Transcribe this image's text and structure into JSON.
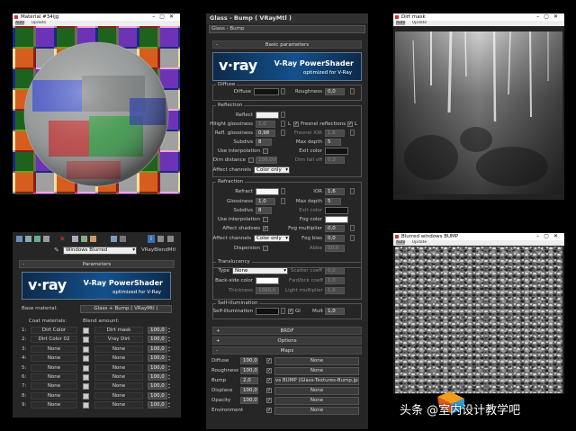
{
  "material_window": {
    "title": "Material #34ijg",
    "menu": [
      "Auto",
      "Update"
    ]
  },
  "editor": {
    "title": "Glass - Bump  ( VRayMtl )",
    "subtitle": "Glass - Bump",
    "rollout_basic": "Basic parameters",
    "banner": {
      "logo": "v·ray",
      "line1": "V-Ray PowerShader",
      "line2": "optimized for V-Ray"
    },
    "diffuse": {
      "group": "Diffuse",
      "diffuse_label": "Diffuse",
      "roughness_label": "Roughness",
      "roughness_value": "0,0"
    },
    "reflection": {
      "group": "Reflection",
      "reflect_label": "Reflect",
      "hilight_label": "Hilight glossiness",
      "hilight_value": "1,0",
      "hilight_L": "L",
      "refl_gloss_label": "Refl. glossiness",
      "refl_gloss_value": "0,98",
      "subdivs_label": "Subdivs",
      "subdivs_value": "8",
      "use_interp_label": "Use interpolation",
      "dim_distance_label": "Dim distance",
      "dim_distance_value": "100,0m",
      "affect_label": "Affect channels",
      "affect_value": "Color only",
      "fresnel_label": "Fresnel reflections",
      "fresnel_L": "L",
      "fresnel_ior_label": "Fresnel IOR",
      "fresnel_ior_value": "1,6",
      "max_depth_label": "Max depth",
      "max_depth_value": "5",
      "exit_color_label": "Exit color",
      "dim_falloff_label": "Dim fall off",
      "dim_falloff_value": "0,0"
    },
    "refraction": {
      "group": "Refraction",
      "refract_label": "Refract",
      "ior_label": "IOR",
      "ior_value": "1,6",
      "glossiness_label": "Glossiness",
      "glossiness_value": "1,0",
      "max_depth_label": "Max depth",
      "max_depth_value": "5",
      "subdivs_label": "Subdivs",
      "subdivs_value": "8",
      "exit_color_label": "Exit color",
      "use_interp_label": "Use interpolation",
      "fog_color_label": "Fog color",
      "affect_shadows_label": "Affect shadows",
      "fog_mult_label": "Fog multiplier",
      "fog_mult_value": "0,0",
      "affect_label": "Affect channels",
      "affect_value": "Color only",
      "fog_bias_label": "Fog bias",
      "fog_bias_value": "0,0",
      "dispersion_label": "Dispersion",
      "abbe_label": "Abbe",
      "abbe_value": "50,0"
    },
    "translucency": {
      "group": "Translucency",
      "type_label": "Type",
      "type_value": "None",
      "backside_label": "Back-side color",
      "thickness_label": "Thickness",
      "thickness_value": "1000,0",
      "scatter_label": "Scatter coeff",
      "scatter_value": "0,0",
      "fwd_label": "Fwd/bck coeff",
      "fwd_value": "1,0",
      "light_label": "Light multiplier",
      "light_value": "1,0"
    },
    "self_illum": {
      "group": "Self-illumination",
      "label": "Self-illumination",
      "gi_label": "GI",
      "mult_label": "Mult",
      "mult_value": "1,0"
    },
    "rollouts": [
      "BRDF",
      "Options",
      "Maps"
    ],
    "maps": [
      {
        "name": "Diffuse",
        "value": "100,0",
        "map": "None"
      },
      {
        "name": "Roughness",
        "value": "100,0",
        "map": "None"
      },
      {
        "name": "Bump",
        "value": "2,0",
        "map": "vs BUMP (Glass-Textures-Bump.jpg)"
      },
      {
        "name": "Displace",
        "value": "100,0",
        "map": "None"
      },
      {
        "name": "Opacity",
        "value": "100,0",
        "map": "None"
      },
      {
        "name": "Environment",
        "value": "",
        "map": "None"
      }
    ]
  },
  "blend_panel": {
    "dropdown_value": "Windows Blurred",
    "type_label": "VRayBlendMtl",
    "rollout": "Parameters",
    "banner": {
      "logo": "v·ray",
      "line1": "V-Ray PowerShader",
      "line2": "optimized for V-Ray"
    },
    "base_label": "Base material:",
    "base_value": "Glass + Bump  ( VRayMtl )",
    "coat_header": "Coat materials:",
    "blend_header": "Blend amount:",
    "rows": [
      {
        "num": "1:",
        "coat": "Dirt Color",
        "blend": "Dirt mask",
        "amt": "100,0"
      },
      {
        "num": "2:",
        "coat": "Dirt Color 02",
        "blend": "Vray Dirt",
        "amt": "100,0"
      },
      {
        "num": "3:",
        "coat": "None",
        "blend": "None",
        "amt": "100,0"
      },
      {
        "num": "4:",
        "coat": "None",
        "blend": "None",
        "amt": "100,0"
      },
      {
        "num": "5:",
        "coat": "None",
        "blend": "None",
        "amt": "100,0"
      },
      {
        "num": "6:",
        "coat": "None",
        "blend": "None",
        "amt": "100,0"
      },
      {
        "num": "7:",
        "coat": "None",
        "blend": "None",
        "amt": "100,0"
      },
      {
        "num": "8:",
        "coat": "None",
        "blend": "None",
        "amt": "100,0"
      },
      {
        "num": "9:",
        "coat": "None",
        "blend": "None",
        "amt": "100,0"
      }
    ]
  },
  "dirt_window": {
    "title": "Dirt mask",
    "menu": [
      "Auto",
      "Update"
    ]
  },
  "bump_window": {
    "title": "Blurred windows BUMP",
    "menu": [
      "Auto",
      "Update"
    ]
  },
  "watermark": "头条 @室内设计教学吧"
}
